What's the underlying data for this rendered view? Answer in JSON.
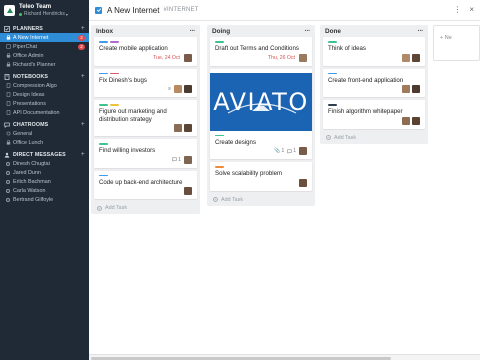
{
  "team": {
    "name": "Teleo Team",
    "user": "Richard Hendricks"
  },
  "planners": {
    "heading": "PLANNERS",
    "items": [
      {
        "label": "A New Internet",
        "badge": "2"
      },
      {
        "label": "PiperChat",
        "badge": "2"
      },
      {
        "label": "Office Admin"
      },
      {
        "label": "Richard's Planner"
      }
    ]
  },
  "notebooks": {
    "heading": "NOTEBOOKS",
    "items": [
      {
        "label": "Compression Algo"
      },
      {
        "label": "Design Ideas"
      },
      {
        "label": "Presentations"
      },
      {
        "label": "API Documentation"
      }
    ]
  },
  "chatrooms": {
    "heading": "CHATROOMS",
    "items": [
      {
        "label": "General"
      },
      {
        "label": "Office Lunch"
      }
    ]
  },
  "direct_messages": {
    "heading": "DIRECT MESSAGES",
    "items": [
      {
        "label": "Dinesh Chugtai"
      },
      {
        "label": "Jared Dunn"
      },
      {
        "label": "Erlich Bachman"
      },
      {
        "label": "Carla Watson"
      },
      {
        "label": "Bertrand Gilfoyle"
      }
    ]
  },
  "board": {
    "title": "A New Internet",
    "tag": "#INTERNET",
    "new_list": "+ Ne"
  },
  "columns": [
    {
      "title": "Inbox",
      "add": "Add Task",
      "cards": [
        {
          "title": "Create mobile application",
          "due": "Tue, 24 Oct"
        },
        {
          "title": "Fix Dinesh's bugs"
        },
        {
          "title": "Figure out marketing and distribution strategy"
        },
        {
          "title": "Find willing investors",
          "comments": "1"
        },
        {
          "title": "Code up back-end architecture"
        }
      ]
    },
    {
      "title": "Doing",
      "add": "Add Task",
      "cards": [
        {
          "title": "Draft out Terms and Conditions",
          "due": "Thu, 26 Oct"
        },
        {
          "title": "Create designs",
          "attachments": "1",
          "comments": "1",
          "image_text": "AVIATO"
        },
        {
          "title": "Solve scalability problem"
        }
      ]
    },
    {
      "title": "Done",
      "add": "Add Task",
      "cards": [
        {
          "title": "Think of ideas"
        },
        {
          "title": "Create front-end application"
        },
        {
          "title": "Finish algorithm whitepaper"
        }
      ]
    }
  ],
  "colors": {
    "sidebar": "#1f2a36",
    "active": "#2f8dd8",
    "aviato": "#1b63b3",
    "due": "#d9534f"
  }
}
